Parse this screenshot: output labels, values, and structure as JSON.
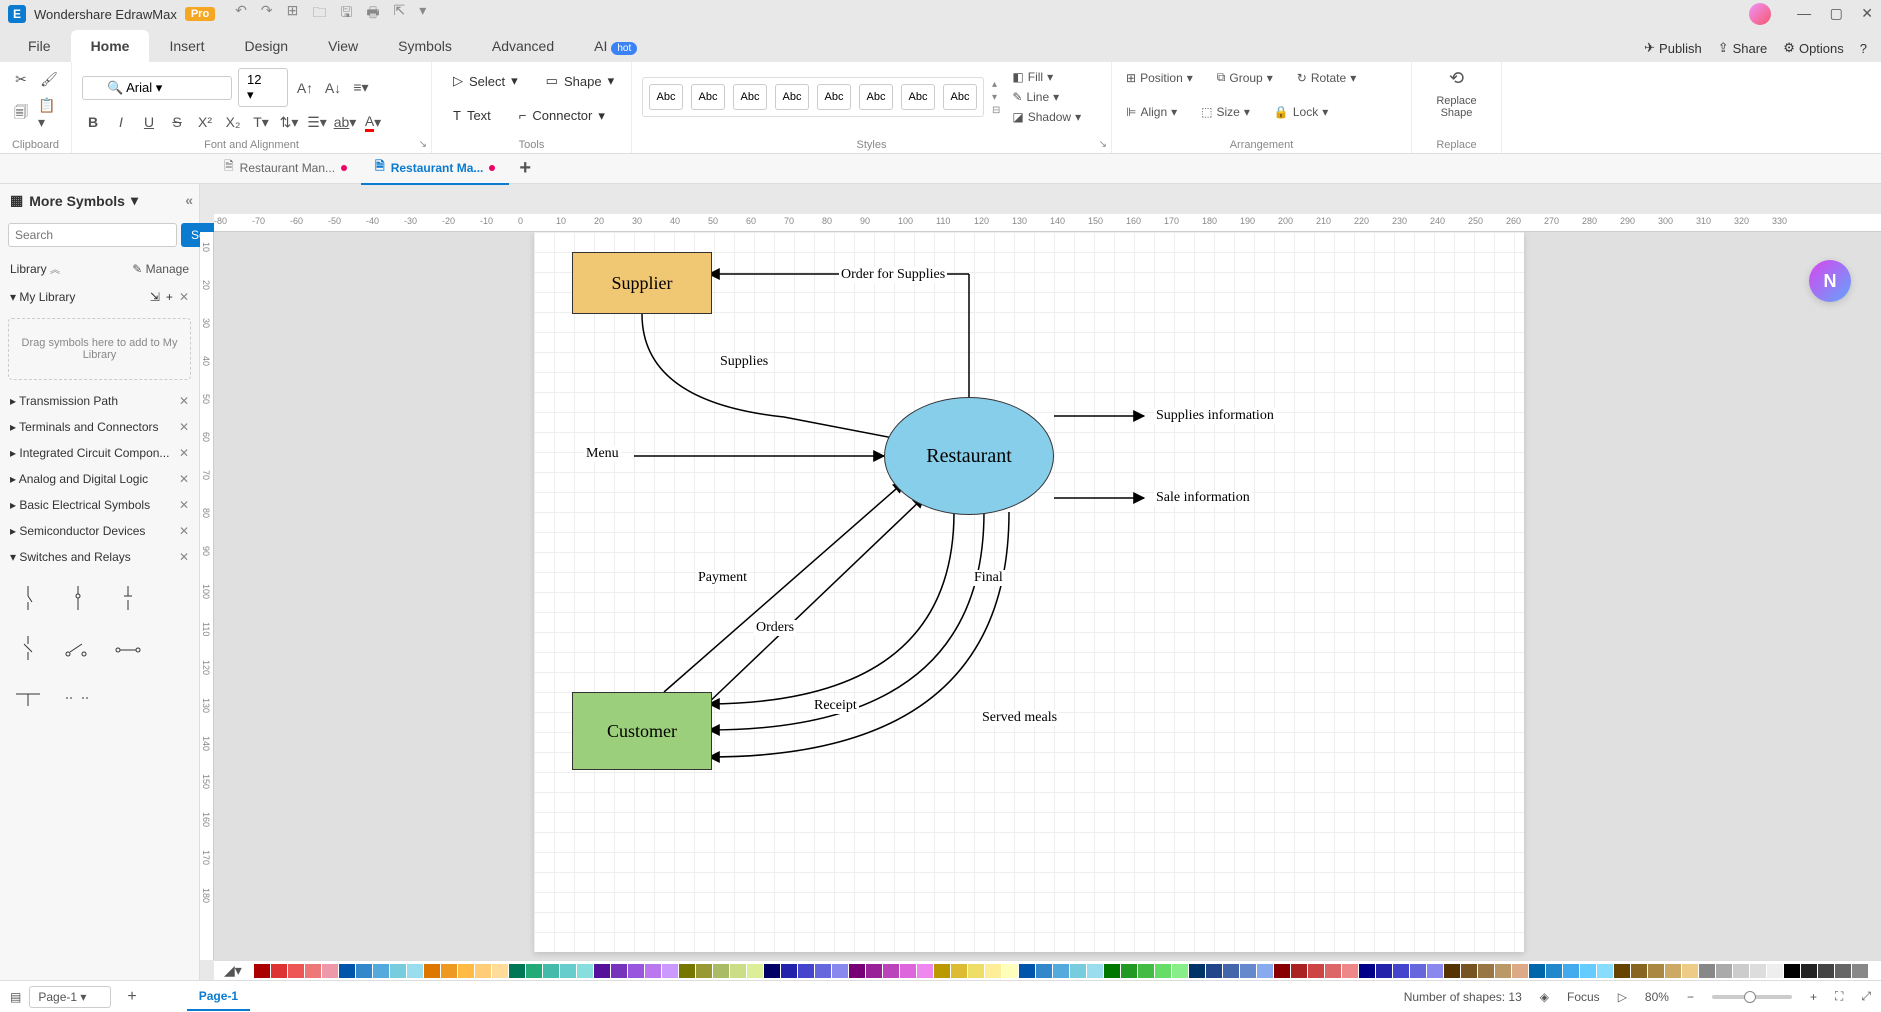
{
  "app": {
    "title": "Wondershare EdrawMax",
    "badge": "Pro"
  },
  "menu": {
    "items": [
      "File",
      "Home",
      "Insert",
      "Design",
      "View",
      "Symbols",
      "Advanced",
      "AI"
    ],
    "active": 1,
    "ai_badge": "hot",
    "right": {
      "publish": "Publish",
      "share": "Share",
      "options": "Options"
    }
  },
  "ribbon": {
    "clipboard": {
      "label": "Clipboard"
    },
    "font": {
      "name": "Arial",
      "size": "12",
      "label": "Font and Alignment"
    },
    "tools": {
      "select": "Select",
      "text": "Text",
      "shape": "Shape",
      "connector": "Connector",
      "label": "Tools"
    },
    "styles": {
      "swatch_label": "Abc",
      "count": 8,
      "label": "Styles",
      "fill": "Fill",
      "line": "Line",
      "shadow": "Shadow"
    },
    "arrangement": {
      "position": "Position",
      "group": "Group",
      "rotate": "Rotate",
      "align": "Align",
      "size": "Size",
      "lock": "Lock",
      "label": "Arrangement"
    },
    "replace": {
      "btn1": "Replace Shape",
      "btn2": "Replace"
    }
  },
  "doc_tabs": {
    "tabs": [
      "Restaurant Man...",
      "Restaurant Ma..."
    ],
    "active": 1
  },
  "sidebar": {
    "title": "More Symbols",
    "search_placeholder": "Search",
    "search_btn": "Search",
    "library_label": "Library",
    "manage_label": "Manage",
    "my_library": "My Library",
    "drop_hint": "Drag symbols here to add to My Library",
    "categories": [
      "Transmission Path",
      "Terminals and Connectors",
      "Integrated Circuit Compon...",
      "Analog and Digital Logic",
      "Basic Electrical Symbols",
      "Semiconductor Devices",
      "Switches and Relays"
    ]
  },
  "ruler_h": [
    "-80",
    "-70",
    "-60",
    "-50",
    "-40",
    "-30",
    "-20",
    "-10",
    "0",
    "10",
    "20",
    "30",
    "40",
    "50",
    "60",
    "70",
    "80",
    "90",
    "100",
    "110",
    "120",
    "130",
    "140",
    "150",
    "160",
    "170",
    "180",
    "190",
    "200",
    "210",
    "220",
    "230",
    "240",
    "250",
    "260",
    "270",
    "280",
    "290",
    "300",
    "310",
    "320",
    "330"
  ],
  "ruler_v": [
    "10",
    "20",
    "30",
    "40",
    "50",
    "60",
    "70",
    "80",
    "90",
    "100",
    "110",
    "120",
    "130",
    "140",
    "150",
    "160",
    "170",
    "180"
  ],
  "diagram": {
    "supplier": "Supplier",
    "customer": "Customer",
    "restaurant": "Restaurant",
    "labels": {
      "order_supplies": "Order for Supplies",
      "supplies": "Supplies",
      "menu": "Menu",
      "supplies_info": "Supplies information",
      "sale_info": "Sale information",
      "payment": "Payment",
      "orders": "Orders",
      "receipt": "Receipt",
      "final": "Final",
      "served_meals": "Served meals"
    },
    "colors": {
      "supplier": "#f0c773",
      "customer": "#9ccf7b",
      "restaurant": "#87ceeb"
    }
  },
  "status": {
    "page_select": "Page-1",
    "page_tab": "Page-1",
    "shapes": "Number of shapes: 13",
    "focus": "Focus",
    "zoom": "80%"
  },
  "colors": [
    "#a00",
    "#d33",
    "#e55",
    "#e77",
    "#e9a",
    "#05a",
    "#38c",
    "#5ad",
    "#7cd",
    "#9de",
    "#d70",
    "#e92",
    "#fb4",
    "#fc7",
    "#fd9",
    "#075",
    "#2a7",
    "#4ba",
    "#6cc",
    "#8dd",
    "#519",
    "#73b",
    "#95d",
    "#b7e",
    "#c9f",
    "#770",
    "#993",
    "#ab6",
    "#cd8",
    "#de9",
    "#006",
    "#22a",
    "#44c",
    "#66d",
    "#88e",
    "#707",
    "#929",
    "#b4b",
    "#d6d",
    "#e8e",
    "#b90",
    "#db3",
    "#ed6",
    "#fe9",
    "#ffb",
    "#05a",
    "#38c",
    "#5ad",
    "#7cd",
    "#9de",
    "#070",
    "#292",
    "#4b4",
    "#6d6",
    "#8e8",
    "#036",
    "#248",
    "#46a",
    "#68c",
    "#8ae",
    "#800",
    "#a22",
    "#c44",
    "#d66",
    "#e88",
    "#008",
    "#22a",
    "#44c",
    "#66d",
    "#88e",
    "#530",
    "#752",
    "#974",
    "#b96",
    "#da8",
    "#06a",
    "#28c",
    "#4ae",
    "#6cf",
    "#8df",
    "#640",
    "#862",
    "#a84",
    "#ca6",
    "#ec8",
    "#888",
    "#aaa",
    "#ccc",
    "#ddd",
    "#eee",
    "#000",
    "#222",
    "#444",
    "#666",
    "#888"
  ]
}
